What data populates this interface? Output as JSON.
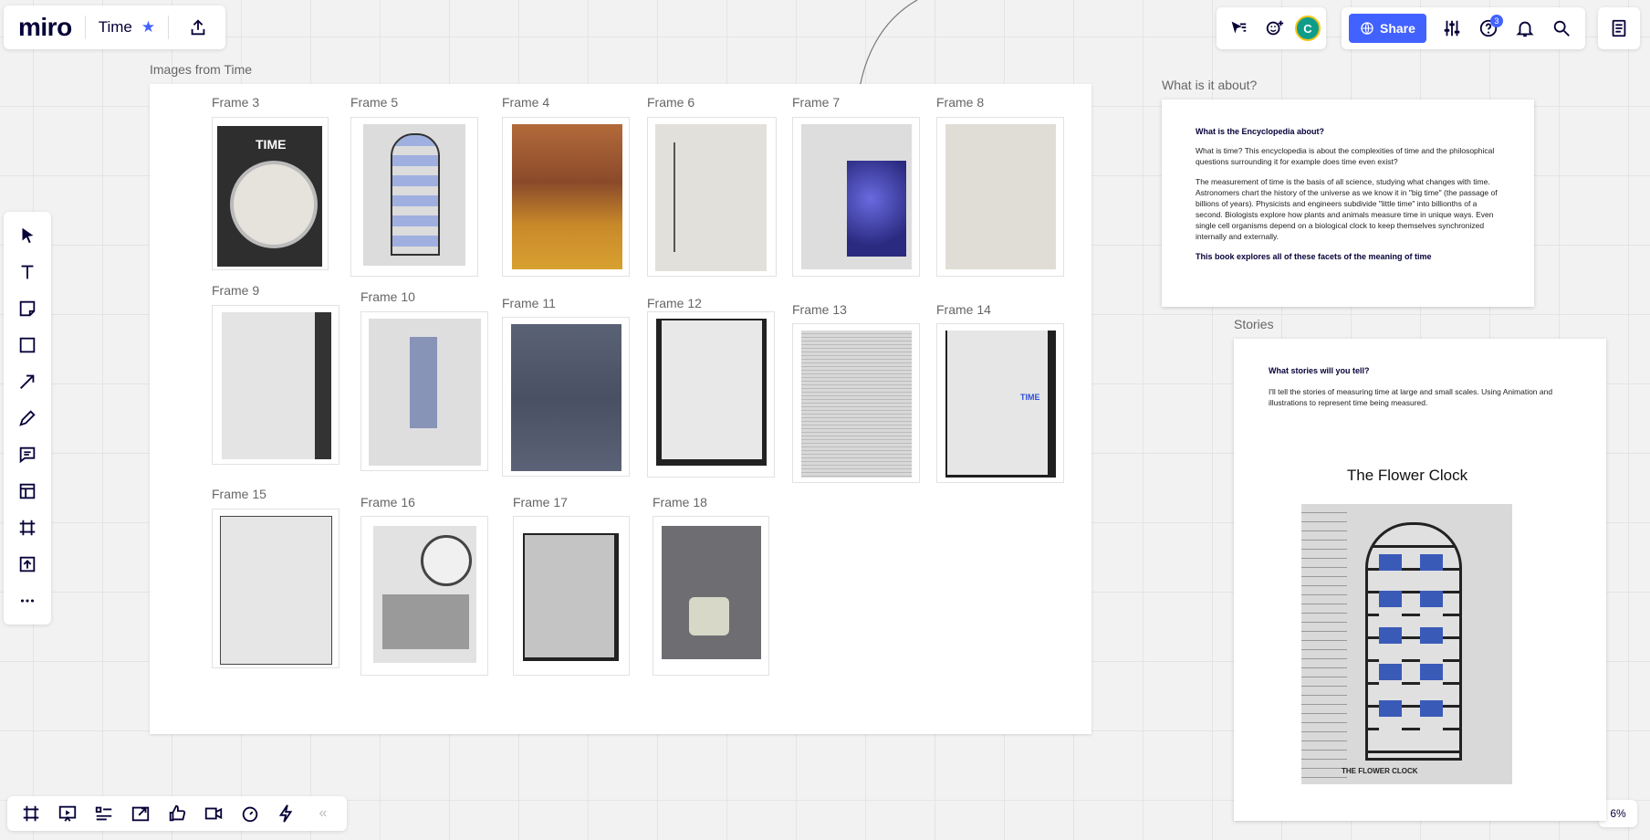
{
  "app": {
    "logo": "miro",
    "board_title": "Time"
  },
  "header": {
    "share_label": "Share",
    "avatar_initial": "C",
    "help_badge": "3"
  },
  "zoom": "6%",
  "main_frame": {
    "title": "Images from Time",
    "frames": [
      {
        "title": "Frame 3"
      },
      {
        "title": "Frame 5"
      },
      {
        "title": "Frame 4"
      },
      {
        "title": "Frame 6"
      },
      {
        "title": "Frame 7"
      },
      {
        "title": "Frame 8"
      },
      {
        "title": "Frame 9"
      },
      {
        "title": "Frame 10"
      },
      {
        "title": "Frame 11"
      },
      {
        "title": "Frame 12"
      },
      {
        "title": "Frame 13"
      },
      {
        "title": "Frame 14"
      },
      {
        "title": "Frame 15"
      },
      {
        "title": "Frame 16"
      },
      {
        "title": "Frame 17"
      },
      {
        "title": "Frame 18"
      }
    ],
    "cover_text": "TIME",
    "cover_text_small": "TIME"
  },
  "about": {
    "title": "What is it about?",
    "heading": "What is the Encyclopedia about?",
    "p1": "What is time? This encyclopedia is about the complexities of time and the philosophical questions surrounding it for example does time even exist?",
    "p2": "The measurement of time is the basis of all science, studying what changes with time. Astronomers chart the history of the universe as we know it in \"big time\" (the passage of billions of years). Physicists and engineers subdivide \"little time\" into billionths of a second. Biologists explore how plants and animals measure time in unique ways. Even single cell organisms depend on a biological clock to keep themselves synchronized internally and externally.",
    "p3": "This book explores all of these facets of the meaning of time"
  },
  "stories": {
    "title": "Stories",
    "heading": "What stories will you tell?",
    "p1": "I'll tell the stories of measuring time at large and small scales. Using Animation and illustrations to represent time being measured.",
    "subheading": "The Flower Clock",
    "caption": "THE FLOWER CLOCK"
  }
}
